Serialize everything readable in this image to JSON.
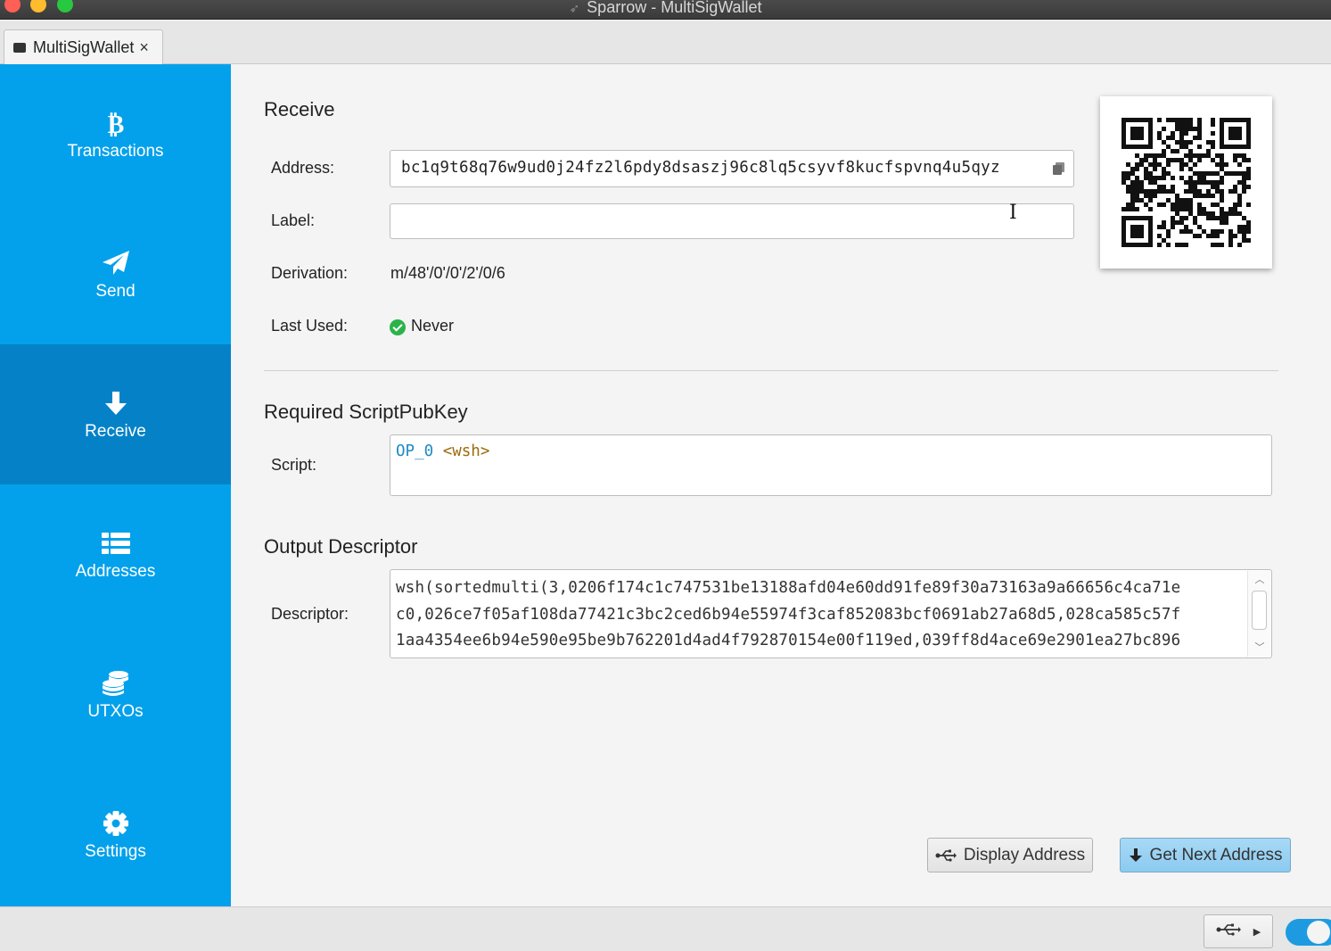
{
  "window": {
    "title": "Sparrow - MultiSigWallet"
  },
  "tab": {
    "label": "MultiSigWallet",
    "close": "×"
  },
  "sidebar": {
    "items": [
      {
        "label": "Transactions",
        "icon": "bitcoin-icon"
      },
      {
        "label": "Send",
        "icon": "paper-plane-icon"
      },
      {
        "label": "Receive",
        "icon": "arrow-down-icon",
        "active": true
      },
      {
        "label": "Addresses",
        "icon": "list-icon"
      },
      {
        "label": "UTXOs",
        "icon": "coins-icon"
      },
      {
        "label": "Settings",
        "icon": "gear-icon"
      }
    ]
  },
  "receive": {
    "title": "Receive",
    "address_label": "Address:",
    "address_value": "bc1q9t68q76w9ud0j24fz2l6pdy8dsaszj96c8lq5csyvf8kucfspvnq4u5qyz",
    "label_label": "Label:",
    "label_value": "",
    "derivation_label": "Derivation:",
    "derivation_value": "m/48'/0'/0'/2'/0/6",
    "last_used_label": "Last Used:",
    "last_used_value": "Never"
  },
  "scriptpubkey": {
    "title": "Required ScriptPubKey",
    "script_label": "Script:",
    "opcode": "OP_0",
    "arg": "<wsh>"
  },
  "descriptor": {
    "title": "Output Descriptor",
    "label": "Descriptor:",
    "lines": [
      "wsh(sortedmulti(3,0206f174c1c747531be13188afd04e60dd91fe89f30a73163a9a66656c4ca71e",
      "c0,026ce7f05af108da77421c3bc2ced6b94e55974f3caf852083bcf0691ab27a68d5,028ca585c57f",
      "1aa4354ee6b94e590e95be9b762201d4ad4f792870154e00f119ed,039ff8d4ace69e2901ea27bc896"
    ]
  },
  "actions": {
    "display_address": "Display Address",
    "get_next_address": "Get Next Address"
  },
  "status": {
    "toggle_on": true
  },
  "colors": {
    "sidebar": "#03a1eb",
    "sidebar_active": "#0582c7",
    "primary_button": "#8ccaf0",
    "success": "#2bb34b"
  }
}
